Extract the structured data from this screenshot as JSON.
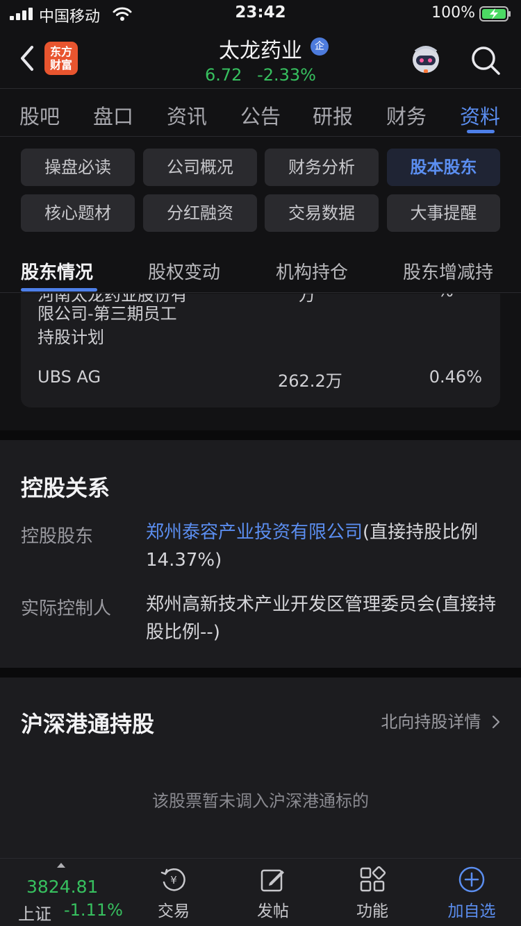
{
  "status_bar": {
    "carrier": "中国移动",
    "time": "23:42",
    "battery": "100%"
  },
  "header": {
    "logo_line1": "东方",
    "logo_line2": "财富",
    "stock_name": "太龙药业",
    "enterprise_badge": "企",
    "price": "6.72",
    "change_pct": "-2.33%"
  },
  "main_tabs": [
    {
      "label": "股吧"
    },
    {
      "label": "盘口"
    },
    {
      "label": "资讯"
    },
    {
      "label": "公告"
    },
    {
      "label": "研报"
    },
    {
      "label": "财务"
    },
    {
      "label": "资料"
    }
  ],
  "quick_buttons": [
    {
      "label": "操盘必读"
    },
    {
      "label": "公司概况"
    },
    {
      "label": "财务分析"
    },
    {
      "label": "股本股东"
    },
    {
      "label": "核心题材"
    },
    {
      "label": "分红融资"
    },
    {
      "label": "交易数据"
    },
    {
      "label": "大事提醒"
    }
  ],
  "sub_tabs": [
    {
      "label": "股东情况"
    },
    {
      "label": "股权变动"
    },
    {
      "label": "机构持仓"
    },
    {
      "label": "股东增减持"
    }
  ],
  "holders": {
    "cut_name": "河南太龙药业股份有",
    "cut_amount": "万",
    "cut_pct": "%",
    "multi_line_1": "限公司-第三期员工",
    "multi_line_2": "持股计划",
    "ubs_name": "UBS AG",
    "ubs_amount": "262.2万",
    "ubs_pct": "0.46%"
  },
  "control": {
    "title": "控股关系",
    "holder_label": "控股股东",
    "holder_link": "郑州泰容产业投资有限公司",
    "holder_note": "(直接持股比例14.37%)",
    "controller_label": "实际控制人",
    "controller_value": "郑州高新技术产业开发区管理委员会(直接持股比例--)"
  },
  "hk_connect": {
    "title": "沪深港通持股",
    "more": "北向持股详情",
    "empty": "该股票暂未调入沪深港通标的"
  },
  "bottom_bar": {
    "index_value": "3824.81",
    "index_name": "上证",
    "index_change": "-1.11%",
    "trade": "交易",
    "post": "发帖",
    "functions": "功能",
    "add_watch": "加自选"
  },
  "colors": {
    "accent": "#5b8ef0",
    "down": "#37c05f",
    "logo": "#e8552f"
  }
}
